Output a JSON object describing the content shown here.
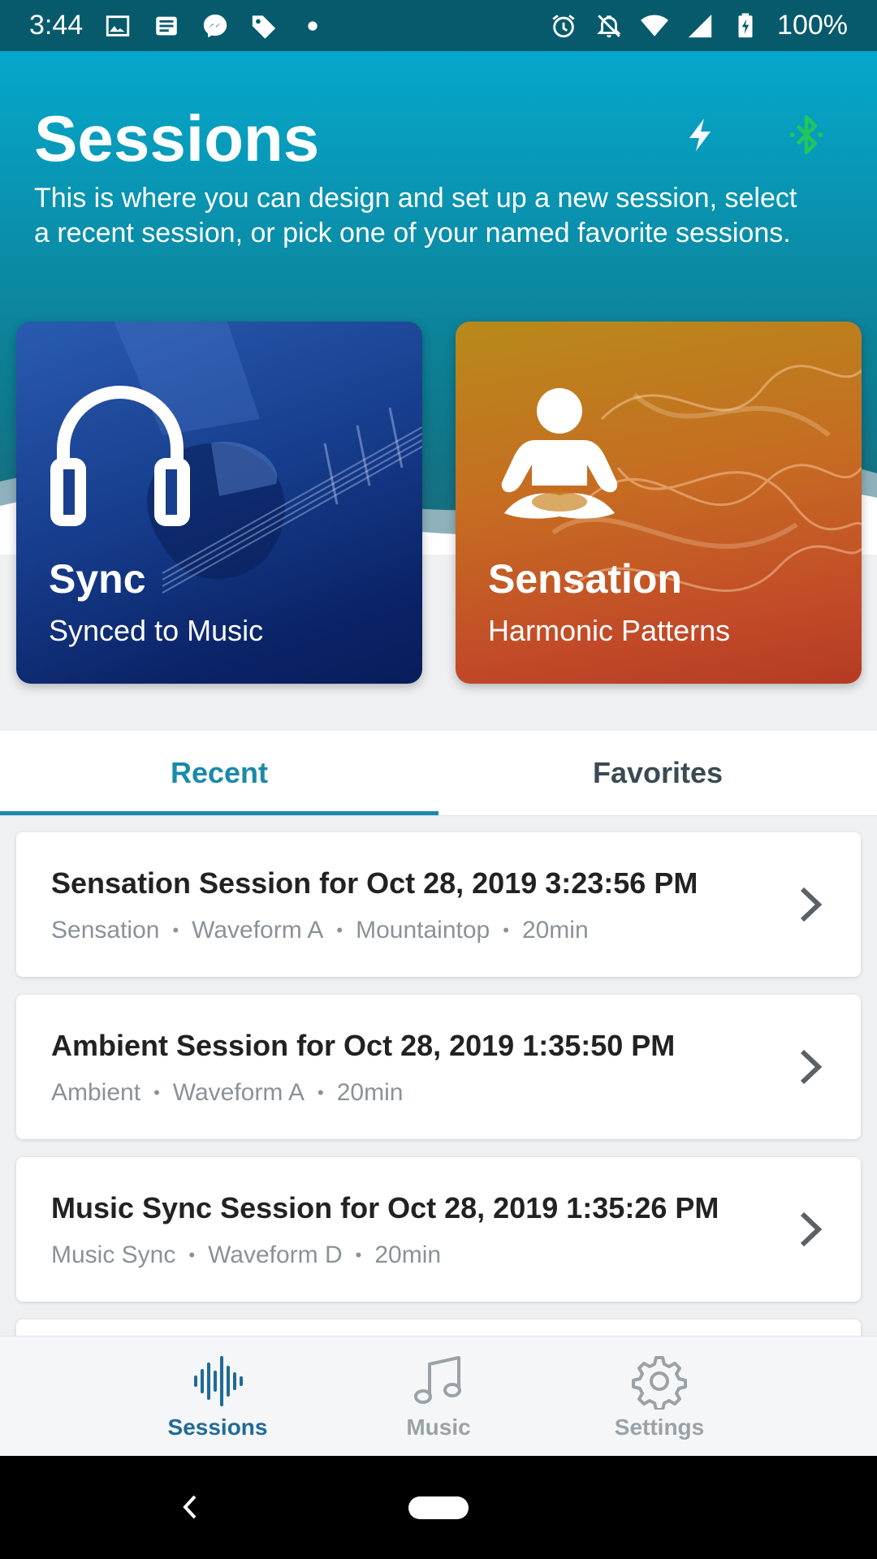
{
  "status_bar": {
    "time": "3:44",
    "battery": "100%",
    "left_icons": [
      "image-icon",
      "news-icon",
      "messenger-icon",
      "tag-icon",
      "dot-icon"
    ],
    "right_icons": [
      "alarm-icon",
      "bell-off-icon",
      "wifi-icon",
      "signal-icon",
      "battery-charging-icon"
    ]
  },
  "header": {
    "title": "Sessions",
    "description": "This is where you can design and set up a new session, select a recent session, or pick one of your named favorite sessions.",
    "actions": [
      "flash-icon",
      "bluetooth-icon"
    ],
    "bluetooth_color": "#22c55e",
    "gradient_top": "#05a8cc"
  },
  "cards": [
    {
      "title": "Sync",
      "subtitle": "Synced to Music",
      "icon": "headphones-icon",
      "color": "#173e8e"
    },
    {
      "title": "Sensation",
      "subtitle": "Harmonic Patterns",
      "icon": "meditation-icon",
      "color": "#c66c22"
    }
  ],
  "tabs": [
    {
      "label": "Recent",
      "active": true
    },
    {
      "label": "Favorites",
      "active": false
    }
  ],
  "accent_color": "#1a8aa8",
  "sessions": [
    {
      "title": "Sensation Session for Oct 28, 2019 3:23:56 PM",
      "meta": [
        "Sensation",
        "Waveform A",
        "Mountaintop",
        "20min"
      ]
    },
    {
      "title": "Ambient Session for Oct 28, 2019 1:35:50 PM",
      "meta": [
        "Ambient",
        "Waveform A",
        "20min"
      ]
    },
    {
      "title": "Music Sync Session for Oct 28, 2019 1:35:26 PM",
      "meta": [
        "Music Sync",
        "Waveform D",
        "20min"
      ]
    }
  ],
  "bottom_nav": [
    {
      "label": "Sessions",
      "icon": "waveform-icon",
      "active": true
    },
    {
      "label": "Music",
      "icon": "music-note-icon",
      "active": false
    },
    {
      "label": "Settings",
      "icon": "gear-icon",
      "active": false
    }
  ],
  "system_nav": [
    "back-icon",
    "home-pill"
  ]
}
